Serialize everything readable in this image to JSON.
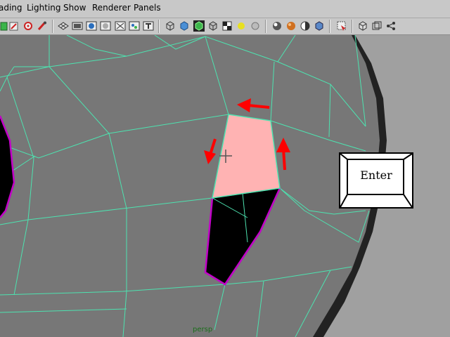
{
  "menubar": {
    "items": [
      {
        "name": "menu-shading",
        "label": "ading"
      },
      {
        "name": "menu-lighting",
        "label": "Lighting"
      },
      {
        "name": "menu-show",
        "label": "Show"
      },
      {
        "name": "menu-renderer",
        "label": "Renderer"
      },
      {
        "name": "menu-panels",
        "label": "Panels"
      }
    ]
  },
  "toolbar": {
    "icons": [
      "cube-select-icon",
      "paint-icon",
      "target-icon",
      "brush-icon",
      "grid-icon",
      "film-gate-icon",
      "resolution-gate-icon",
      "safe-frame-icon",
      "hud-icon",
      "text-icon",
      "wireframe-cube-icon",
      "smooth-shaded-cube-icon",
      "wireframe-on-shaded-icon",
      "textured-cube-icon",
      "checker-icon",
      "light-icon",
      "sphere-icon",
      "shaded-sphere-icon",
      "material-icon",
      "contrast-icon",
      "shadow-icon",
      "xray-icon",
      "isolate-icon",
      "frame-icon",
      "share-icon"
    ]
  },
  "colors": {
    "face": "#777777",
    "edge": "#4de3b0",
    "selected_face": "#ffb3b3",
    "hole": "#000000",
    "border_edge": "#c200c8",
    "arrow": "#ff0000",
    "camera_label": "#1a6e1a"
  },
  "enter_key": {
    "label": "Enter"
  },
  "viewport": {
    "camera": "persp"
  }
}
